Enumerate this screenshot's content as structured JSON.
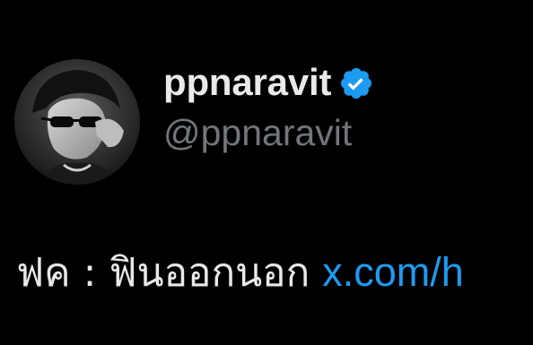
{
  "colors": {
    "background": "#000000",
    "primary_text": "#e7e9ea",
    "secondary_text": "#71767b",
    "link": "#1d9bf0",
    "verified_badge": "#1d9bf0"
  },
  "author": {
    "display_name": "ppnaravit",
    "handle": "@ppnaravit",
    "verified": true,
    "verified_icon": "verified-badge-icon"
  },
  "tweet": {
    "text": "ฟค : ฟินออกนอก ",
    "link_text": "x.com/h"
  }
}
